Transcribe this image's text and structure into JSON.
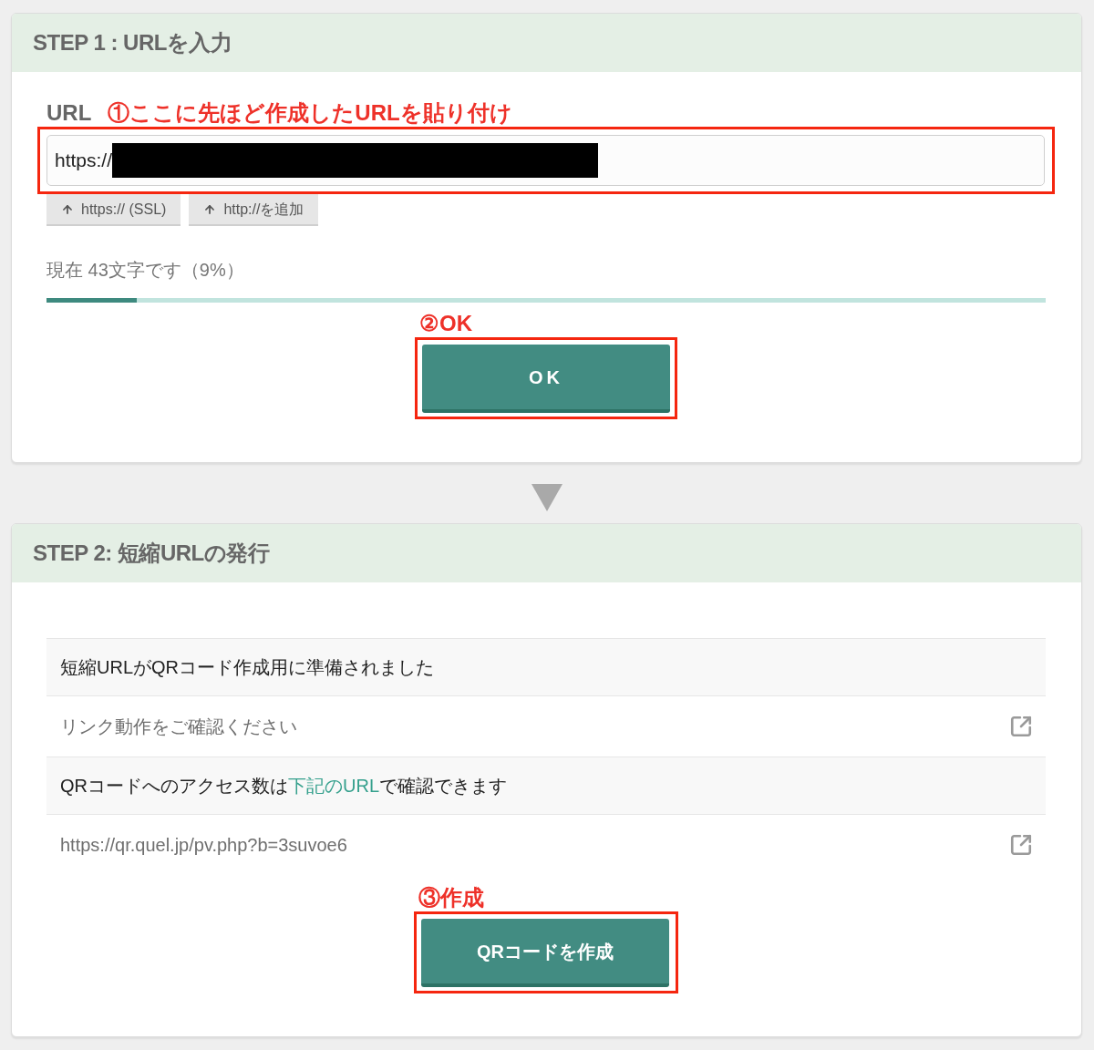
{
  "step1": {
    "title": "STEP 1 : URLを入力",
    "url_label": "URL",
    "annotation": "①ここに先ほど作成したURLを貼り付け",
    "url_field": {
      "value": "https://",
      "redacted": true,
      "highlighted": true
    },
    "prefix_buttons": [
      "https:// (SSL)",
      "http://を追加"
    ],
    "char_count": "現在 43文字です（9%）",
    "progress": {
      "level": 0.09
    },
    "ok_annotation": "②OK",
    "ok_button": {
      "label": "OK",
      "highlighted": true
    }
  },
  "step2": {
    "title": "STEP 2: 短縮URLの発行",
    "rows": [
      {
        "kind": "message",
        "text": "短縮URLがQRコード作成用に準備されました"
      },
      {
        "kind": "link",
        "text": "リンク動作をご確認ください"
      },
      {
        "kind": "message_with_link",
        "before": "QRコードへのアクセス数は",
        "link": "下記のURL",
        "after": "で確認できます"
      },
      {
        "kind": "link",
        "text": "https://qr.quel.jp/pv.php?b=3suvoe6"
      }
    ],
    "create_annotation": "③作成",
    "create_button": {
      "label": "QRコードを作成",
      "highlighted": true
    }
  }
}
